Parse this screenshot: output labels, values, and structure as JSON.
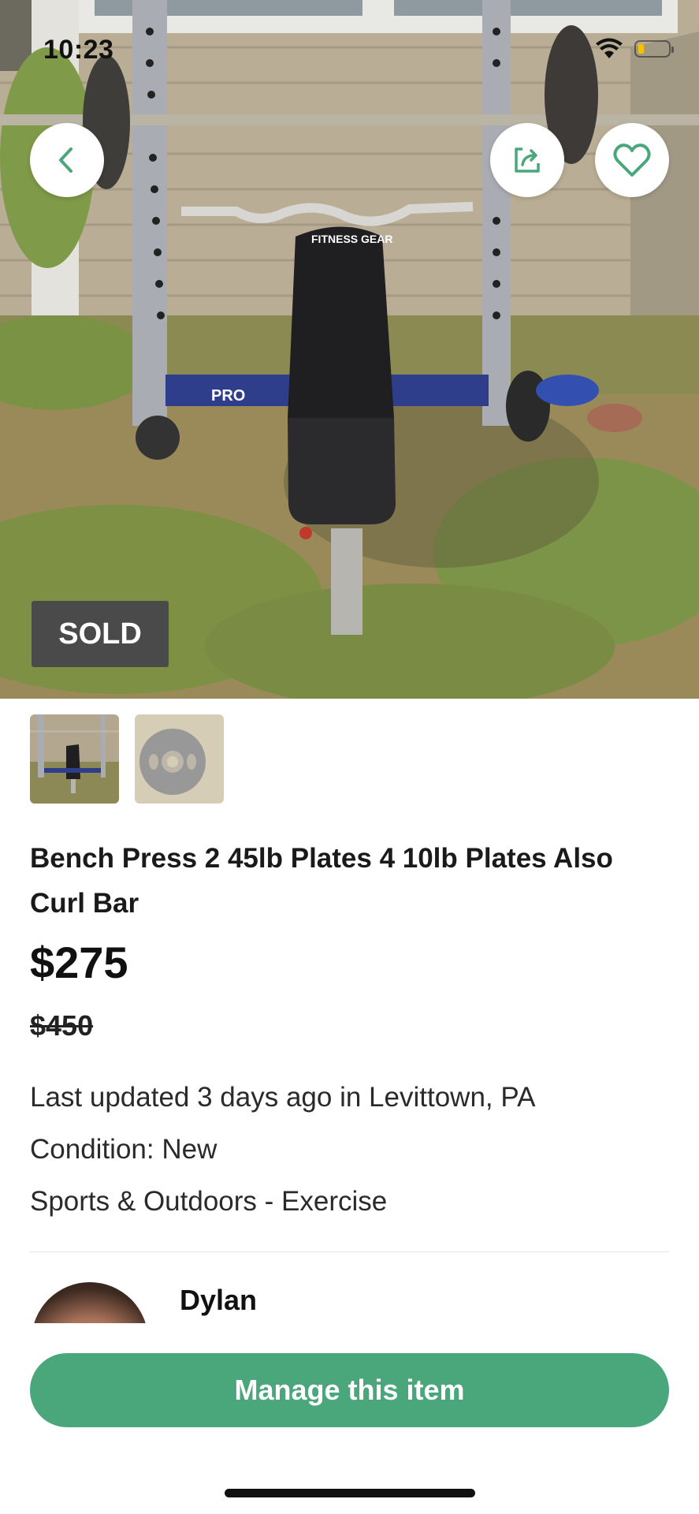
{
  "status_bar": {
    "time": "10:23"
  },
  "hero": {
    "badge": "SOLD",
    "back_icon": "chevron-left-icon",
    "share_icon": "share-icon",
    "favorite_icon": "heart-icon",
    "accent_color": "#4aa67b",
    "bench_logo_text": "FITNESS GEAR",
    "rack_text": "PRO"
  },
  "thumbnails": [
    {
      "label": "bench-photo"
    },
    {
      "label": "plate-photo"
    }
  ],
  "listing": {
    "title": "Bench Press 2 45lb Plates 4 10lb Plates Also Curl Bar",
    "price": "$275",
    "original_price": "$450",
    "updated": "Last updated 3 days ago in Levittown, PA",
    "condition": "Condition: New",
    "category": "Sports & Outdoors - Exercise"
  },
  "seller": {
    "name": "Dylan"
  },
  "actions": {
    "manage_label": "Manage this item"
  }
}
